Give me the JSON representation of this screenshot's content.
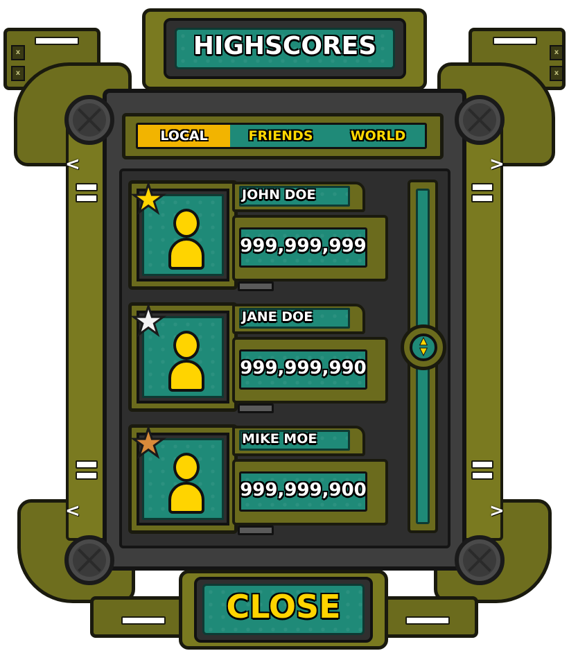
{
  "title": "HIGHSCORES",
  "tabs": [
    {
      "label": "LOCAL",
      "active": true
    },
    {
      "label": "FRIENDS",
      "active": false
    },
    {
      "label": "WORLD",
      "active": false
    }
  ],
  "scores": [
    {
      "rank": 1,
      "name": "JOHN DOE",
      "score": "999,999,999",
      "star_color": "#ffd400",
      "star_icon": "gold-star-icon"
    },
    {
      "rank": 2,
      "name": "JANE DOE",
      "score": "999,999,990",
      "star_color": "#f2f2f2",
      "star_icon": "silver-star-icon"
    },
    {
      "rank": 3,
      "name": "MIKE MOE",
      "score": "999,999,900",
      "star_color": "#d98a3a",
      "star_icon": "bronze-star-icon"
    }
  ],
  "close_label": "CLOSE",
  "scroll_position": 0.47,
  "colors": {
    "olive": "#6b6b1d",
    "teal": "#1f8a78",
    "accent_yellow": "#ffd400",
    "tab_active": "#f2b400",
    "panel_dark": "#3e3e3e"
  }
}
